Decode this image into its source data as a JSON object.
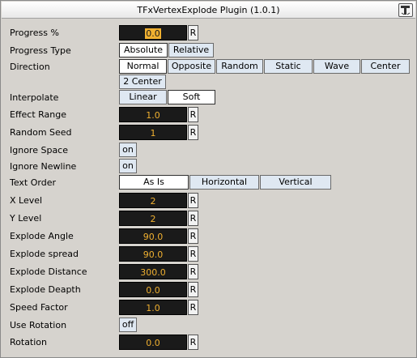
{
  "window": {
    "title": "TFxVertexExplode Plugin (1.0.1)"
  },
  "reset_label": "R",
  "rows": {
    "progress": {
      "label": "Progress %",
      "value": "0.0"
    },
    "progress_type": {
      "label": "Progress Type",
      "options": [
        "Absolute",
        "Relative"
      ],
      "selected": "Absolute"
    },
    "direction": {
      "label": "Direction",
      "options": [
        "Normal",
        "Opposite",
        "Random",
        "Static",
        "Wave",
        "Center",
        "2 Center"
      ],
      "selected": "Normal"
    },
    "interpolate": {
      "label": "Interpolate",
      "options": [
        "Linear",
        "Soft"
      ],
      "selected": "Soft"
    },
    "effect_range": {
      "label": "Effect Range",
      "value": "1.0"
    },
    "random_seed": {
      "label": "Random Seed",
      "value": "1"
    },
    "ignore_space": {
      "label": "Ignore Space",
      "value": "on"
    },
    "ignore_newline": {
      "label": "Ignore Newline",
      "value": "on"
    },
    "text_order": {
      "label": "Text Order",
      "options": [
        "As Is",
        "Horizontal",
        "Vertical"
      ],
      "selected": "As Is"
    },
    "x_level": {
      "label": "X Level",
      "value": "2"
    },
    "y_level": {
      "label": "Y Level",
      "value": "2"
    },
    "explode_angle": {
      "label": "Explode Angle",
      "value": "90.0"
    },
    "explode_spread": {
      "label": "Explode spread",
      "value": "90.0"
    },
    "explode_distance": {
      "label": "Explode Distance",
      "value": "300.0"
    },
    "explode_deapth": {
      "label": "Explode Deapth",
      "value": "0.0"
    },
    "speed_factor": {
      "label": "Speed Factor",
      "value": "1.0"
    },
    "use_rotation": {
      "label": "Use Rotation",
      "value": "off"
    },
    "rotation": {
      "label": "Rotation",
      "value": "0.0"
    }
  },
  "colors": {
    "field_bg": "#1a1a1a",
    "field_text": "#f0b030",
    "option_bg": "#dfe8f2",
    "option_active": "#ffffff"
  },
  "icons": {
    "title": "plugin-settings-icon"
  }
}
